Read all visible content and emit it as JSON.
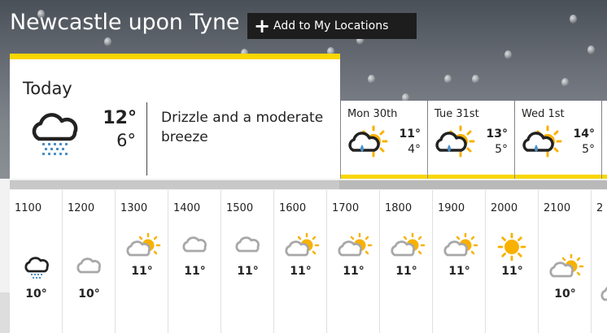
{
  "location": {
    "title": "Newcastle upon Tyne",
    "add_label": "Add to My Locations"
  },
  "today": {
    "label": "Today",
    "icon": "drizzle-icon",
    "high": "12°",
    "low": "6°",
    "description": "Drizzle and a moderate breeze"
  },
  "days": [
    {
      "name": "Mon 30th",
      "icon": "light-rain-sunny-intervals-icon",
      "high": "11°",
      "low": "4°"
    },
    {
      "name": "Tue 31st",
      "icon": "light-rain-sunny-intervals-icon",
      "high": "13°",
      "low": "5°"
    },
    {
      "name": "Wed 1st",
      "icon": "light-rain-sunny-intervals-icon",
      "high": "14°",
      "low": "5°"
    }
  ],
  "hours": [
    {
      "time": "1100",
      "icon": "drizzle-icon",
      "temp": "10°"
    },
    {
      "time": "1200",
      "icon": "light-cloud-icon",
      "temp": "10°"
    },
    {
      "time": "1300",
      "icon": "sunny-intervals-icon",
      "temp": "11°"
    },
    {
      "time": "1400",
      "icon": "light-cloud-icon",
      "temp": "11°"
    },
    {
      "time": "1500",
      "icon": "light-cloud-icon",
      "temp": "11°"
    },
    {
      "time": "1600",
      "icon": "sunny-intervals-icon",
      "temp": "11°"
    },
    {
      "time": "1700",
      "icon": "sunny-intervals-icon",
      "temp": "11°"
    },
    {
      "time": "1800",
      "icon": "sunny-intervals-icon",
      "temp": "11°"
    },
    {
      "time": "1900",
      "icon": "sunny-intervals-icon",
      "temp": "11°"
    },
    {
      "time": "2000",
      "icon": "sunny-icon",
      "temp": "11°"
    },
    {
      "time": "2100",
      "icon": "sunny-intervals-icon",
      "temp": "10°"
    },
    {
      "time": "2",
      "icon": "light-cloud-icon",
      "temp": ""
    }
  ],
  "colors": {
    "accent": "#f9d700",
    "cloud": "#a8a8a8",
    "rain": "#4a90c8",
    "sun": "#f9b100",
    "dark": "#222222"
  }
}
